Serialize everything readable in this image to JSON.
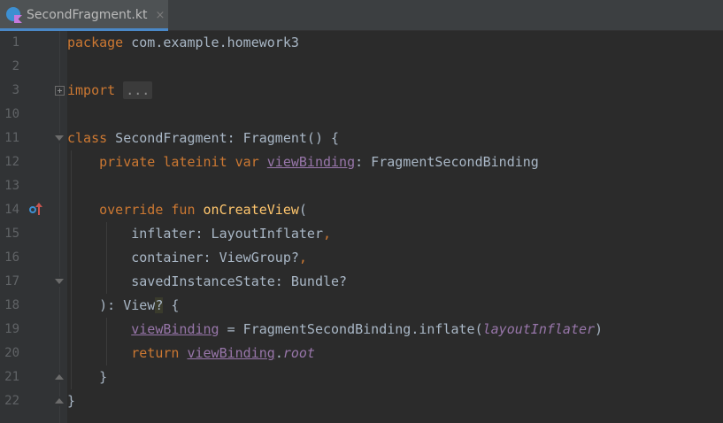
{
  "tab": {
    "title": "SecondFragment.kt",
    "close": "×",
    "icon": "kotlin-file-icon"
  },
  "lines": [
    {
      "num": "1",
      "tokens": [
        {
          "t": "package",
          "c": "kw"
        },
        {
          "t": " com.example.homework3",
          "c": ""
        }
      ]
    },
    {
      "num": "2",
      "tokens": []
    },
    {
      "num": "3",
      "tokens": [
        {
          "t": "import",
          "c": "kw"
        },
        {
          "t": " ",
          "c": ""
        },
        {
          "t": "...",
          "c": "folded"
        }
      ]
    },
    {
      "num": "10",
      "tokens": []
    },
    {
      "num": "11",
      "tokens": [
        {
          "t": "class",
          "c": "kw"
        },
        {
          "t": " SecondFragment: Fragment() {",
          "c": ""
        }
      ]
    },
    {
      "num": "12",
      "tokens": [
        {
          "t": "    ",
          "c": ""
        },
        {
          "t": "private lateinit var",
          "c": "kw"
        },
        {
          "t": " ",
          "c": ""
        },
        {
          "t": "viewBinding",
          "c": "prop"
        },
        {
          "t": ": FragmentSecondBinding",
          "c": ""
        }
      ]
    },
    {
      "num": "13",
      "tokens": []
    },
    {
      "num": "14",
      "tokens": [
        {
          "t": "    ",
          "c": ""
        },
        {
          "t": "override fun",
          "c": "kw"
        },
        {
          "t": " ",
          "c": ""
        },
        {
          "t": "onCreateView",
          "c": "fn"
        },
        {
          "t": "(",
          "c": ""
        }
      ]
    },
    {
      "num": "15",
      "tokens": [
        {
          "t": "        inflater: LayoutInflater",
          "c": ""
        },
        {
          "t": ",",
          "c": "kw"
        }
      ]
    },
    {
      "num": "16",
      "tokens": [
        {
          "t": "        container: ViewGroup?",
          "c": ""
        },
        {
          "t": ",",
          "c": "kw"
        }
      ]
    },
    {
      "num": "17",
      "tokens": [
        {
          "t": "        savedInstanceState: Bundle?",
          "c": ""
        }
      ]
    },
    {
      "num": "18",
      "tokens": [
        {
          "t": "    ): View",
          "c": ""
        },
        {
          "t": "?",
          "c": "caret-hl"
        },
        {
          "t": " {",
          "c": ""
        }
      ]
    },
    {
      "num": "19",
      "tokens": [
        {
          "t": "        ",
          "c": ""
        },
        {
          "t": "viewBinding",
          "c": "prop"
        },
        {
          "t": " = FragmentSecondBinding.inflate(",
          "c": ""
        },
        {
          "t": "layoutInflater",
          "c": "ital"
        },
        {
          "t": ")",
          "c": ""
        }
      ]
    },
    {
      "num": "20",
      "tokens": [
        {
          "t": "        ",
          "c": ""
        },
        {
          "t": "return",
          "c": "kw"
        },
        {
          "t": " ",
          "c": ""
        },
        {
          "t": "viewBinding",
          "c": "prop"
        },
        {
          "t": ".",
          "c": ""
        },
        {
          "t": "root",
          "c": "ital"
        }
      ]
    },
    {
      "num": "21",
      "tokens": [
        {
          "t": "    }",
          "c": ""
        }
      ]
    },
    {
      "num": "22",
      "tokens": [
        {
          "t": "}",
          "c": ""
        }
      ]
    }
  ]
}
